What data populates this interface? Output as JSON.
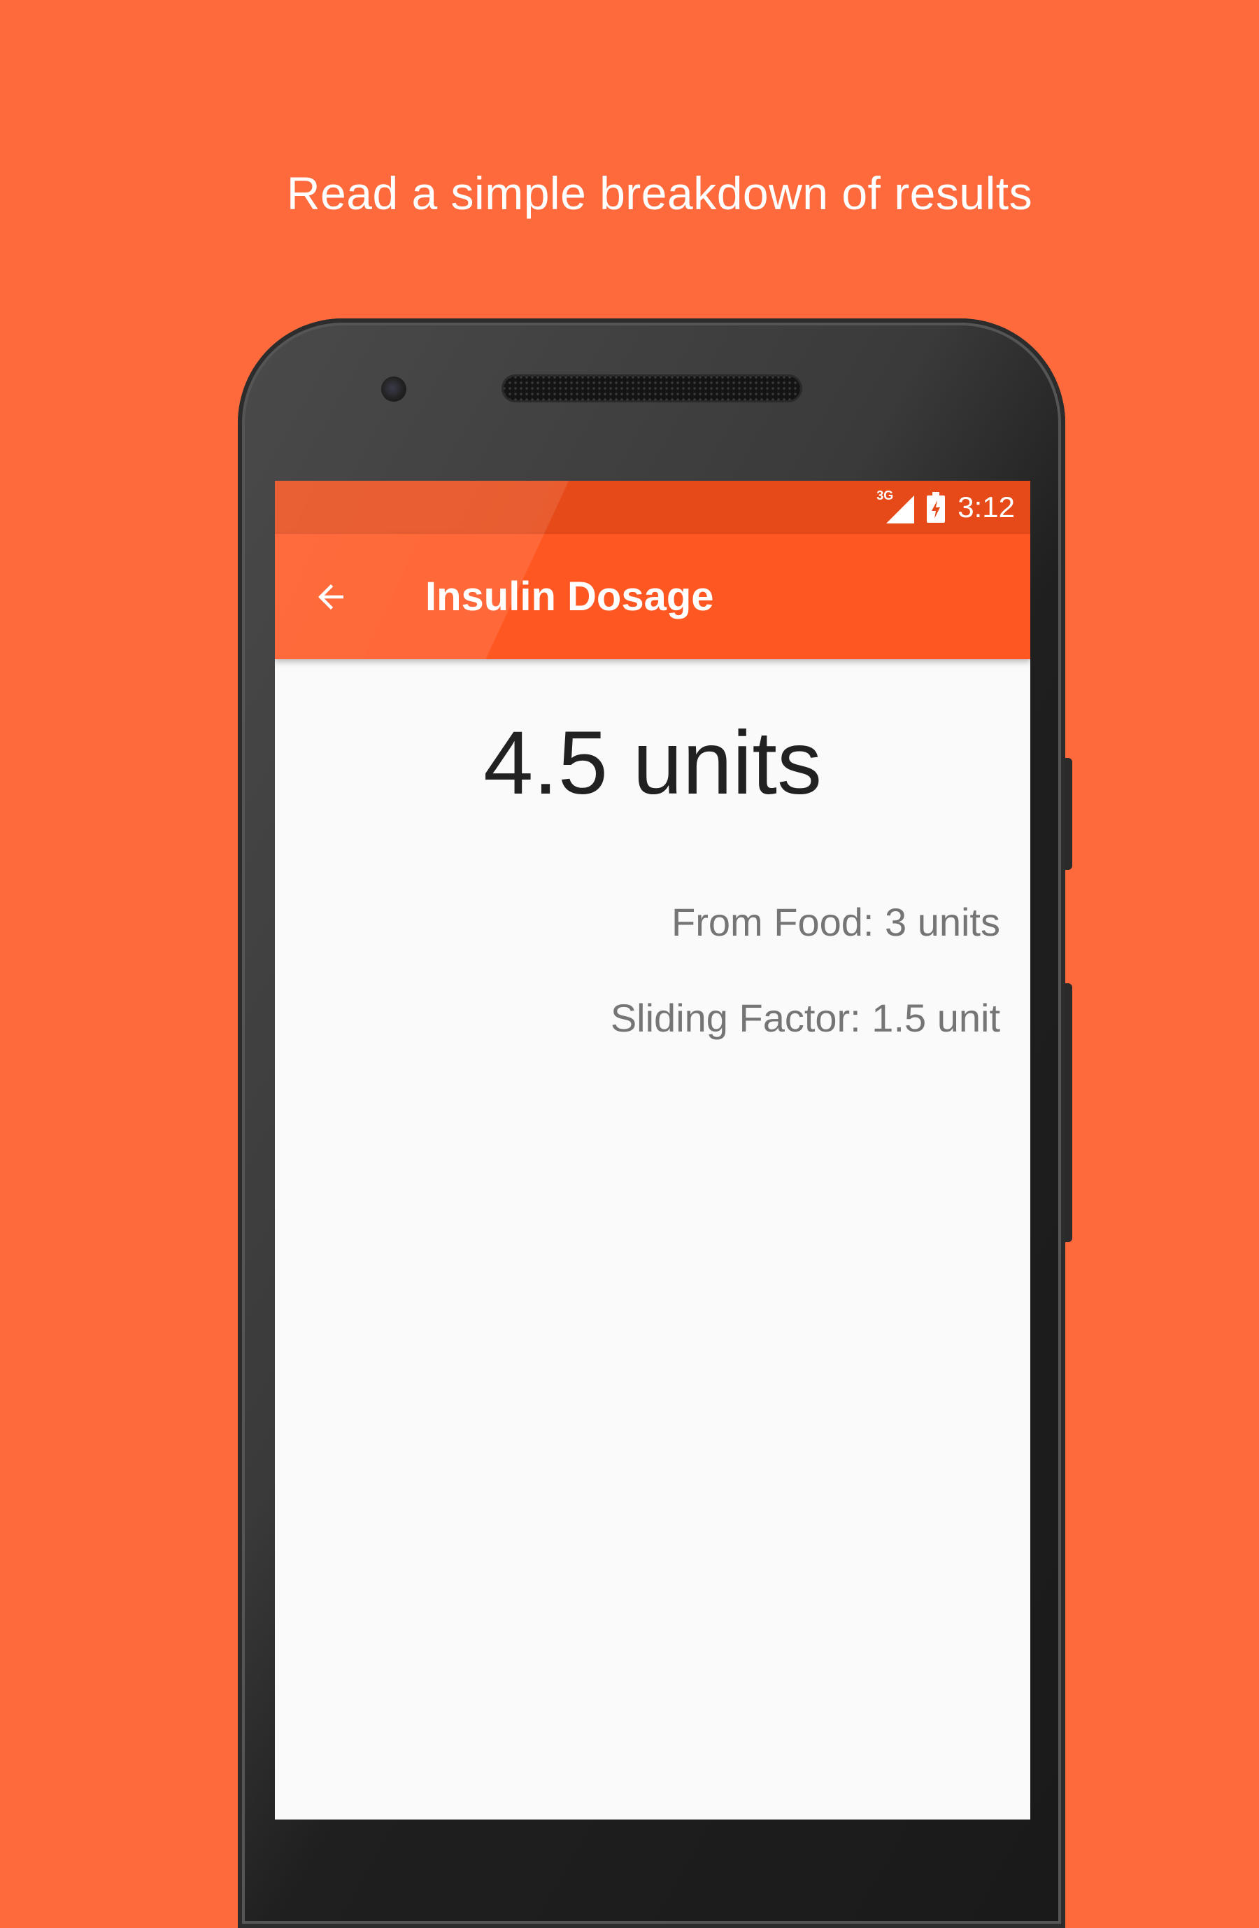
{
  "headline": "Read a simple breakdown of results",
  "status_bar": {
    "network": "3G",
    "time": "3:12",
    "icons": [
      "signal-icon",
      "battery-charging-icon"
    ]
  },
  "app_bar": {
    "back_icon": "arrow-left-icon",
    "title": "Insulin Dosage"
  },
  "result": {
    "total": "4.5 units",
    "from_food": "From Food: 3 units",
    "sliding_factor": "Sliding Factor: 1.5 unit"
  },
  "colors": {
    "background": "#FF6A3D",
    "status_bar": "#E64A19",
    "app_bar": "#FF5722",
    "screen": "#FAFAFA",
    "primary_text": "#212121",
    "secondary_text": "#757575"
  }
}
